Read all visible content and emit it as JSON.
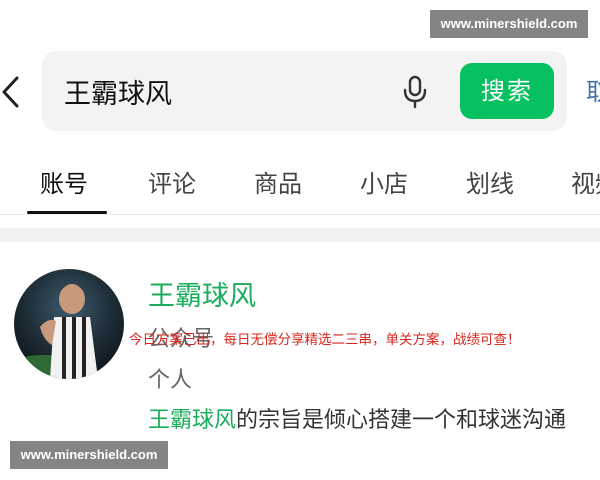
{
  "watermark": {
    "top": "www.minershield.com",
    "bottom": "www.minershield.com"
  },
  "search": {
    "query": "王霸球风",
    "button_label": "搜索",
    "right_cutoff_text": "取"
  },
  "icons": {
    "back": "chevron-left-icon",
    "mic": "microphone-icon"
  },
  "tabs": [
    {
      "label": "账号",
      "active": true
    },
    {
      "label": "评论"
    },
    {
      "label": "商品"
    },
    {
      "label": "小店"
    },
    {
      "label": "划线"
    },
    {
      "label": "视频"
    }
  ],
  "result": {
    "name": "王霸球风",
    "type": "公众号",
    "overlay_note": "今日方案已出，每日无偿分享精选二三串，单关方案，战绩可查！",
    "category": "个人",
    "desc_highlight": "王霸球风",
    "desc_rest": "的宗旨是倾心搭建一个和球迷沟通"
  },
  "colors": {
    "accent_green": "#07c160",
    "name_green": "#1aad5c",
    "overlay_red": "#d9261c"
  }
}
